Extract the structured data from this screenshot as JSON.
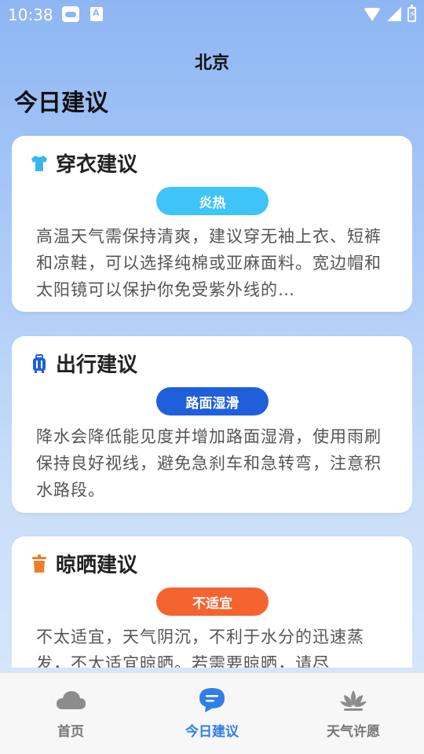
{
  "status_bar": {
    "time": "10:38",
    "icons": [
      "cloud-icon",
      "a-icon",
      "wifi-icon",
      "signal-icon",
      "battery-icon"
    ]
  },
  "header": {
    "city": "北京"
  },
  "page": {
    "title": "今日建议"
  },
  "cards": [
    {
      "icon": "shirt-icon",
      "title": "穿衣建议",
      "badge": "炎热",
      "badge_color": "#3ec4f7",
      "text": "高温天气需保持清爽，建议穿无袖上衣、短裤和凉鞋，可以选择纯棉或亚麻面料。宽边帽和太阳镜可以保护你免受紫外线的…"
    },
    {
      "icon": "luggage-icon",
      "title": "出行建议",
      "badge": "路面湿滑",
      "badge_color": "#1f5fdc",
      "text": "降水会降低能见度并增加路面湿滑，使用雨刷保持良好视线，避免急刹车和急转弯，注意积水路段。"
    },
    {
      "icon": "hanger-icon",
      "title": "晾晒建议",
      "badge": "不适宜",
      "badge_color": "#f5642f",
      "text": "不太适宜，天气阴沉，不利于水分的迅速蒸发，不太适宜晾晒。若需要晾晒，请尽"
    }
  ],
  "bottom_nav": [
    {
      "label": "首页",
      "icon": "cloud-icon",
      "active": false
    },
    {
      "label": "今日建议",
      "icon": "chat-icon",
      "active": true
    },
    {
      "label": "天气许愿",
      "icon": "lotus-icon",
      "active": false
    }
  ],
  "colors": {
    "accent": "#2f7fe6",
    "inactive": "#777777"
  }
}
